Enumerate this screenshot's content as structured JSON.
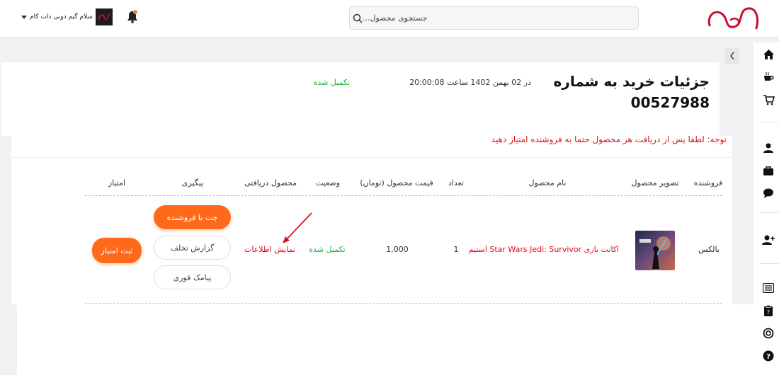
{
  "header": {
    "search_placeholder": "جستجوی محصول...",
    "account_name": "سلام گیم دونی دات کام"
  },
  "order": {
    "title": "جزئیات خرید به شماره 00527988",
    "date": "در 02 بهمن 1402 ساعت 20:00:08",
    "status": "تکمیل شده",
    "notice": "توجه: لطفا پس از دریافت هر محصول حتما به فروشنده امتیاز دهید"
  },
  "table": {
    "headers": {
      "seller": "فروشنده",
      "image": "تصویر محصول",
      "name": "نام محصول",
      "qty": "تعداد",
      "price": "قیمت محصول (تومان)",
      "status": "وضعیت",
      "received": "محصول دریافتی",
      "followup": "پیگیری",
      "rating": "امتیاز"
    },
    "row": {
      "seller": "بالکس",
      "name": "اکانت بازی Star Wars Jedi: Survivor استیم",
      "qty": "1",
      "price": "1,000",
      "status": "تکمیل شده",
      "received_link": "نمایش اطلاعات",
      "chat_label": "چت با فروشنده",
      "report_label": "گزارش تخلف",
      "sms_label": "پیامک فوری",
      "rate_label": "ثبت امتیاز"
    }
  },
  "colors": {
    "accent": "#ff6a1a",
    "success": "#1eb53a",
    "danger": "#e0101e",
    "brand": "#c8102e"
  },
  "icons": [
    "home-icon",
    "coffee-icon",
    "cart-icon",
    "user-icon",
    "briefcase-icon",
    "chat-icon",
    "add-user-icon",
    "list-icon",
    "clipboard-icon",
    "support-icon",
    "help-icon",
    "bell-icon",
    "search-icon",
    "chevron-left-icon"
  ]
}
